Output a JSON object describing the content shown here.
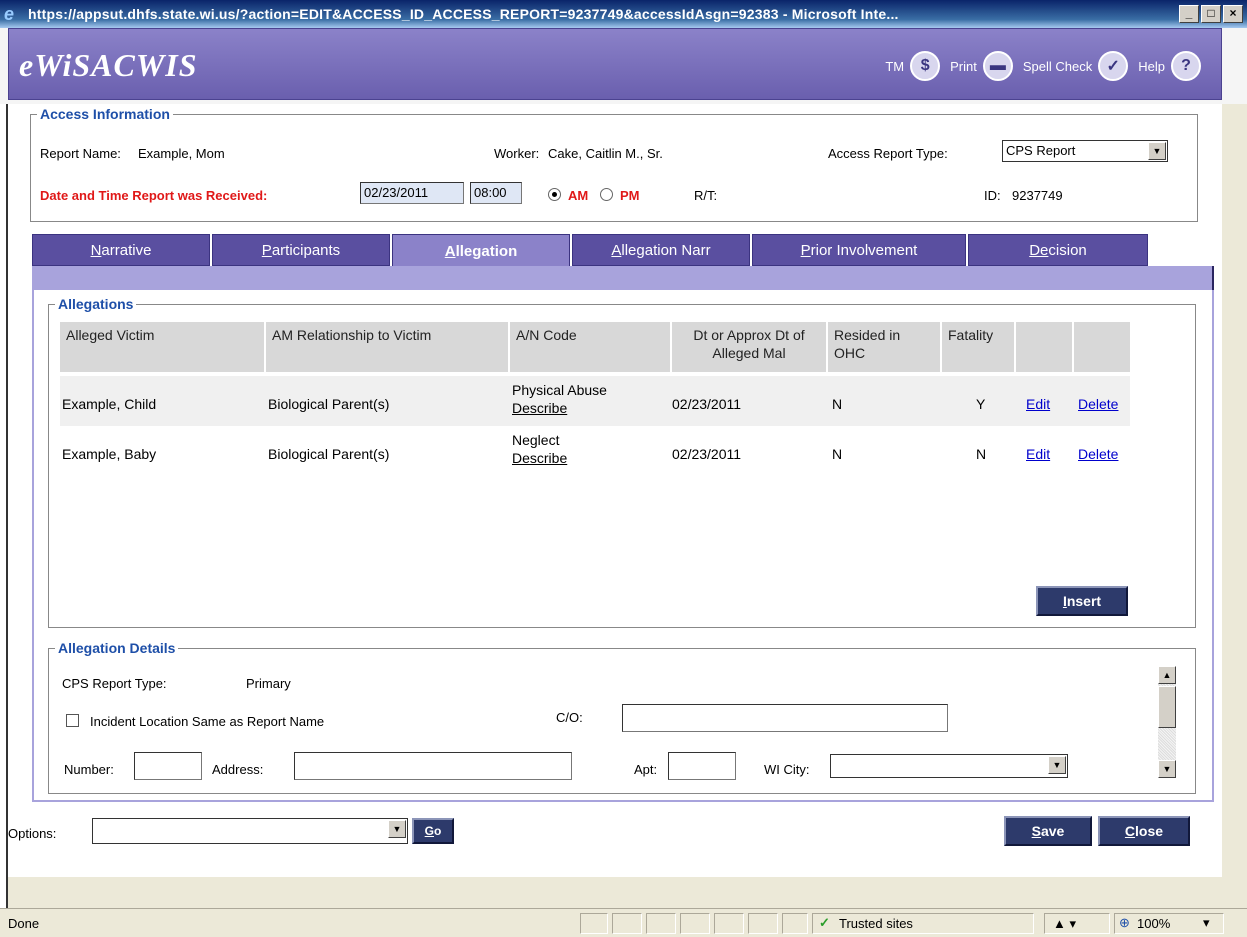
{
  "window": {
    "title": "https://appsut.dhfs.state.wi.us/?action=EDIT&ACCESS_ID_ACCESS_REPORT=9237749&accessIdAsgn=92383 - Microsoft Inte...",
    "minimize": "_",
    "maximize": "□",
    "close": "×"
  },
  "app": {
    "logo": "eWiSACWIS",
    "toolbar": {
      "tm_label": "TM",
      "tm_icon": "$",
      "print_label": "Print",
      "print_icon": "▬",
      "spell_label": "Spell Check",
      "spell_icon": "✓",
      "help_label": "Help",
      "help_icon": "?"
    }
  },
  "access_info": {
    "legend": "Access Information",
    "report_name_label": "Report Name:",
    "report_name": "Example, Mom",
    "worker_label": "Worker:",
    "worker": "Cake, Caitlin M., Sr.",
    "report_type_label": "Access Report Type:",
    "report_type": "CPS Report",
    "received_label": "Date and Time Report was Received:",
    "date": "02/23/2011",
    "time": "08:00",
    "am": "AM",
    "pm": "PM",
    "rt_label": "R/T:",
    "id_label": "ID:",
    "id": "9237749"
  },
  "tabs": [
    {
      "key": "N",
      "rest": "arrative"
    },
    {
      "key": "P",
      "rest": "articipants"
    },
    {
      "key": "A",
      "rest": "llegation"
    },
    {
      "key": "A",
      "rest": "llegation Narr"
    },
    {
      "key": "P",
      "rest": "rior Involvement"
    },
    {
      "key": "De",
      "rest": "cision"
    }
  ],
  "allegations": {
    "legend": "Allegations",
    "columns": [
      "Alleged Victim",
      "AM Relationship to Victim",
      "A/N Code",
      "Dt or Approx Dt of Alleged Mal",
      "Resided in OHC",
      "Fatality",
      "",
      ""
    ],
    "rows": [
      {
        "victim": "Example, Child",
        "relationship": "Biological Parent(s)",
        "code": "Physical Abuse",
        "describe": "Describe",
        "date": "02/23/2011",
        "ohc": "N",
        "fatality": "Y",
        "edit": "Edit",
        "delete": "Delete"
      },
      {
        "victim": "Example, Baby",
        "relationship": "Biological Parent(s)",
        "code": "Neglect",
        "describe": "Describe",
        "date": "02/23/2011",
        "ohc": "N",
        "fatality": "N",
        "edit": "Edit",
        "delete": "Delete"
      }
    ],
    "insert_key": "I",
    "insert_rest": "nsert"
  },
  "details": {
    "legend": "Allegation Details",
    "cps_type_label": "CPS Report Type:",
    "cps_type": "Primary",
    "incident_label": "Incident Location Same as Report Name",
    "co_label": "C/O:",
    "number_label": "Number:",
    "address_label": "Address:",
    "apt_label": "Apt:",
    "city_label": "WI City:"
  },
  "footer": {
    "options_label": "Options:",
    "go_key": "G",
    "go_rest": "o",
    "save_key": "S",
    "save_rest": "ave",
    "close_key": "C",
    "close_rest": "lose"
  },
  "statusbar": {
    "status": "Done",
    "zone": "Trusted sites",
    "zoom": "100%"
  }
}
